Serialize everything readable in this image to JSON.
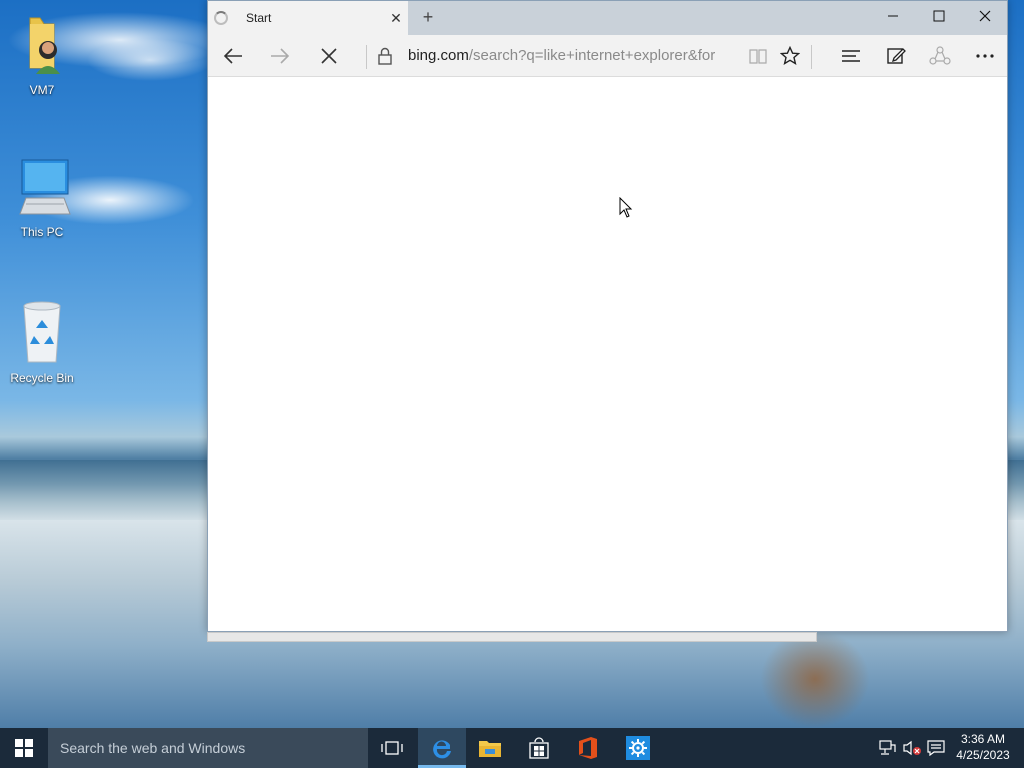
{
  "desktop": {
    "icons": [
      {
        "label": "VM7",
        "icon": "user-folder-icon"
      },
      {
        "label": "This PC",
        "icon": "computer-icon"
      },
      {
        "label": "Recycle Bin",
        "icon": "recycle-bin-icon"
      }
    ]
  },
  "browser": {
    "tab": {
      "title": "Start",
      "close": "✕",
      "state": "loading"
    },
    "new_tab": "+",
    "window_controls": {
      "minimize": "—",
      "maximize": "☐",
      "close": "✕"
    },
    "address": {
      "domain": "bing.com",
      "rest": "/search?q=like+internet+explorer&for"
    },
    "icons": [
      "back-arrow-icon",
      "forward-arrow-icon",
      "stop-icon",
      "lock-icon",
      "reading-view-icon",
      "favorite-star-icon",
      "hub-icon",
      "web-note-icon",
      "share-icon",
      "more-icon"
    ]
  },
  "taskbar": {
    "search_placeholder": "Search the web and Windows",
    "apps": [
      "task-view-icon",
      "edge-icon",
      "file-explorer-icon",
      "store-icon",
      "office-icon",
      "settings-icon"
    ],
    "clock": {
      "time": "3:36 AM",
      "date": "4/25/2023"
    },
    "colors": {
      "bar": "#1b2a3a",
      "accent": "#76b9ed"
    }
  }
}
